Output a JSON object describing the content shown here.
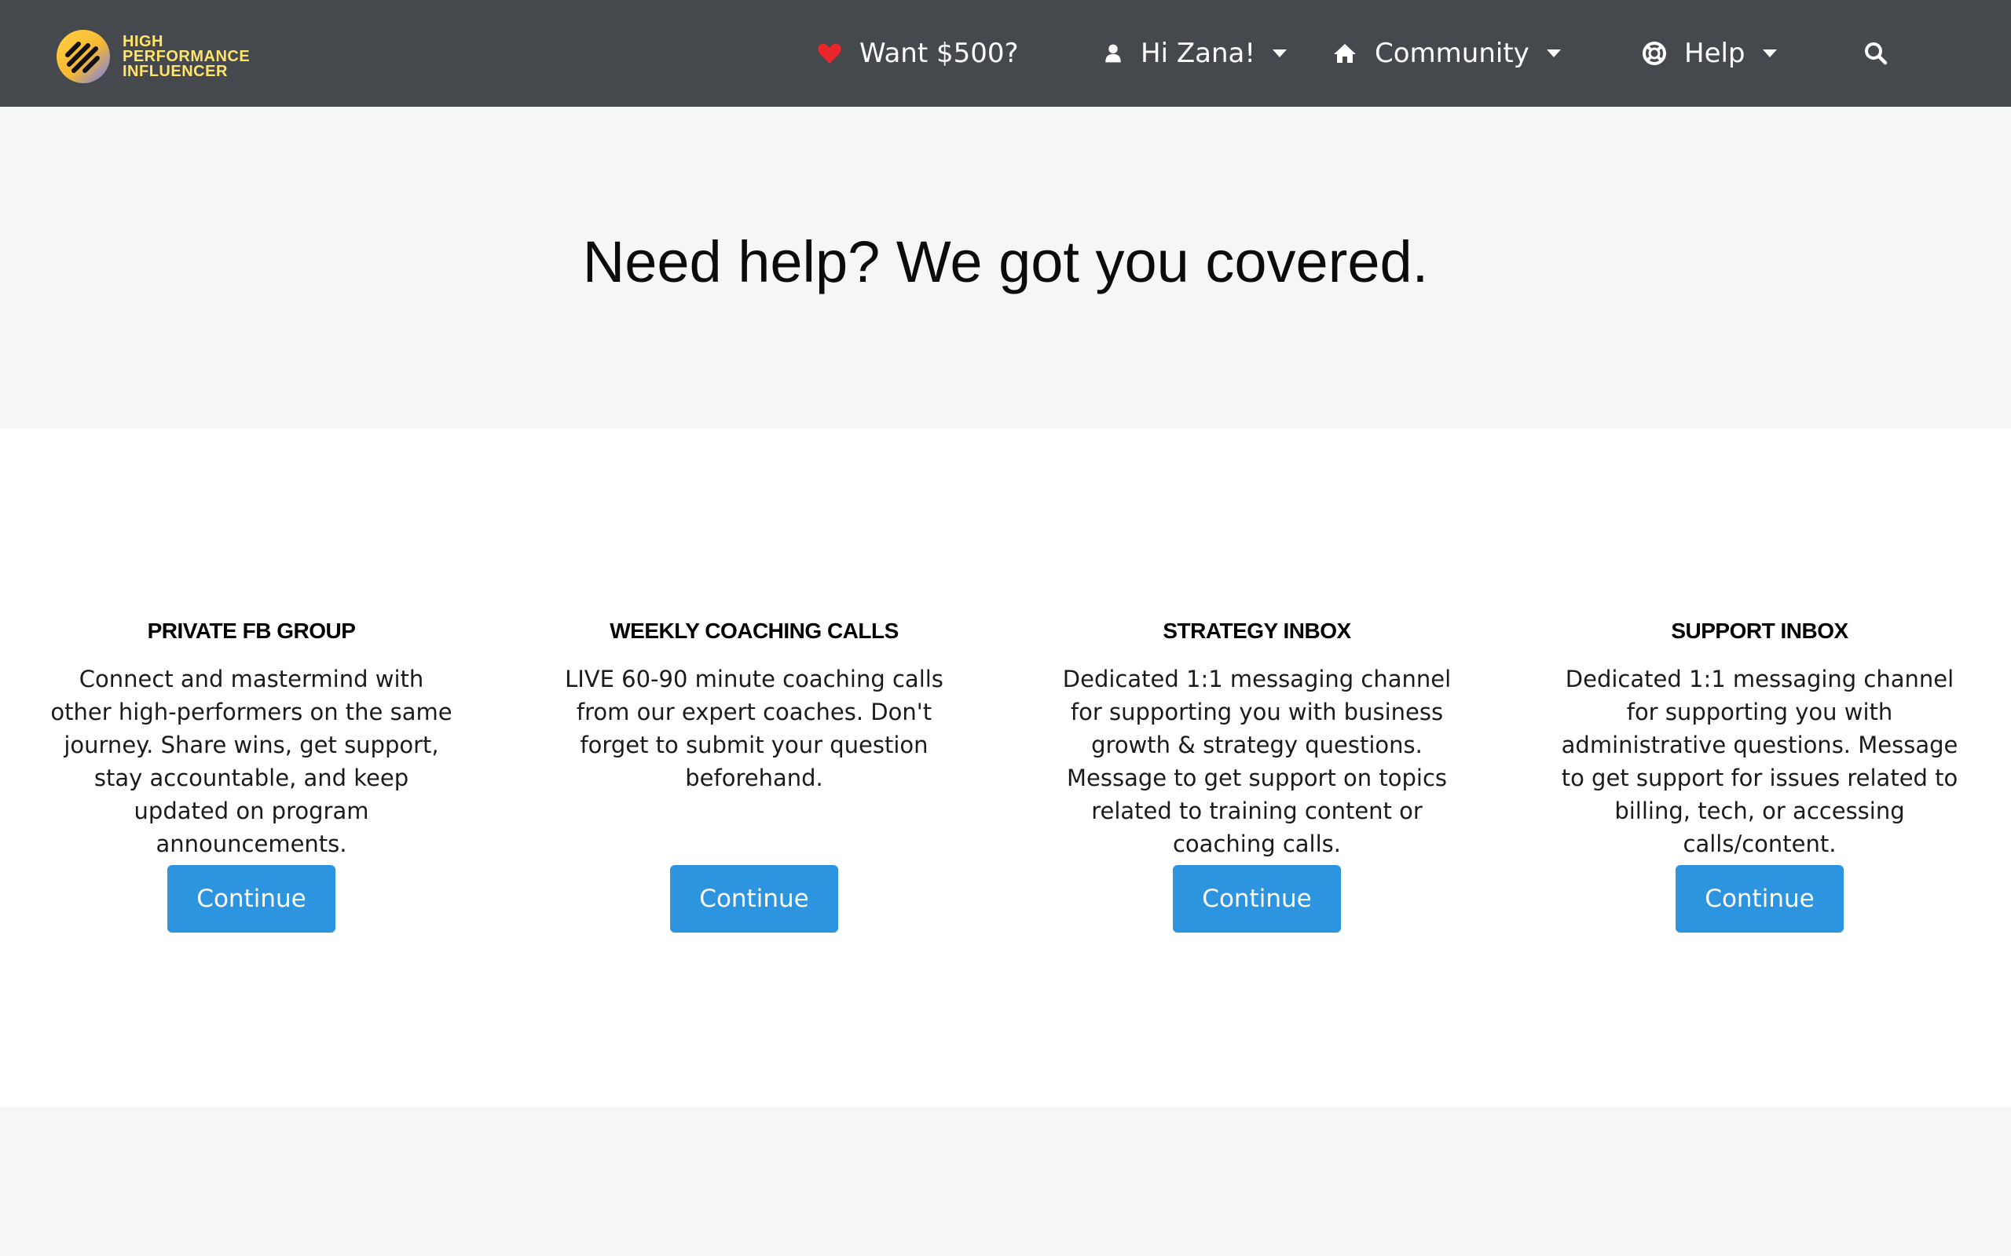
{
  "brand": {
    "logo_lines": [
      "High",
      "Performance",
      "Influencer"
    ],
    "colors": {
      "nav_bg": "#45484d",
      "logo_text": "#ffe36b",
      "heart": "#e8262c",
      "button": "#2d95e0",
      "page_bg": "#f5f6f8"
    }
  },
  "nav": {
    "referral": {
      "icon": "heart-icon",
      "label": "Want $500?"
    },
    "user": {
      "icon": "user-icon",
      "label": "Hi Zana!"
    },
    "community": {
      "icon": "home-icon",
      "label": "Community"
    },
    "help": {
      "icon": "lifebuoy-icon",
      "label": "Help"
    },
    "search": {
      "icon": "search-icon"
    }
  },
  "hero": {
    "title": "Need help? We got you covered."
  },
  "features": [
    {
      "title": "PRIVATE FB GROUP",
      "description": "Connect and mastermind with other high-performers on the same journey. Share wins, get support, stay accountable, and keep updated on program announcements.",
      "button": "Continue"
    },
    {
      "title": "WEEKLY COACHING CALLS",
      "description": "LIVE 60-90 minute coaching calls from our expert coaches. Don't forget to submit your question beforehand.",
      "button": "Continue"
    },
    {
      "title": "STRATEGY INBOX",
      "description": "Dedicated 1:1 messaging channel for supporting you with business growth & strategy questions. Message to get support on topics related to training content or coaching calls.",
      "button": "Continue"
    },
    {
      "title": "SUPPORT INBOX",
      "description": "Dedicated 1:1 messaging channel for supporting you with administrative questions. Message to get support for issues related to billing, tech, or accessing calls/content.",
      "button": "Continue"
    }
  ]
}
